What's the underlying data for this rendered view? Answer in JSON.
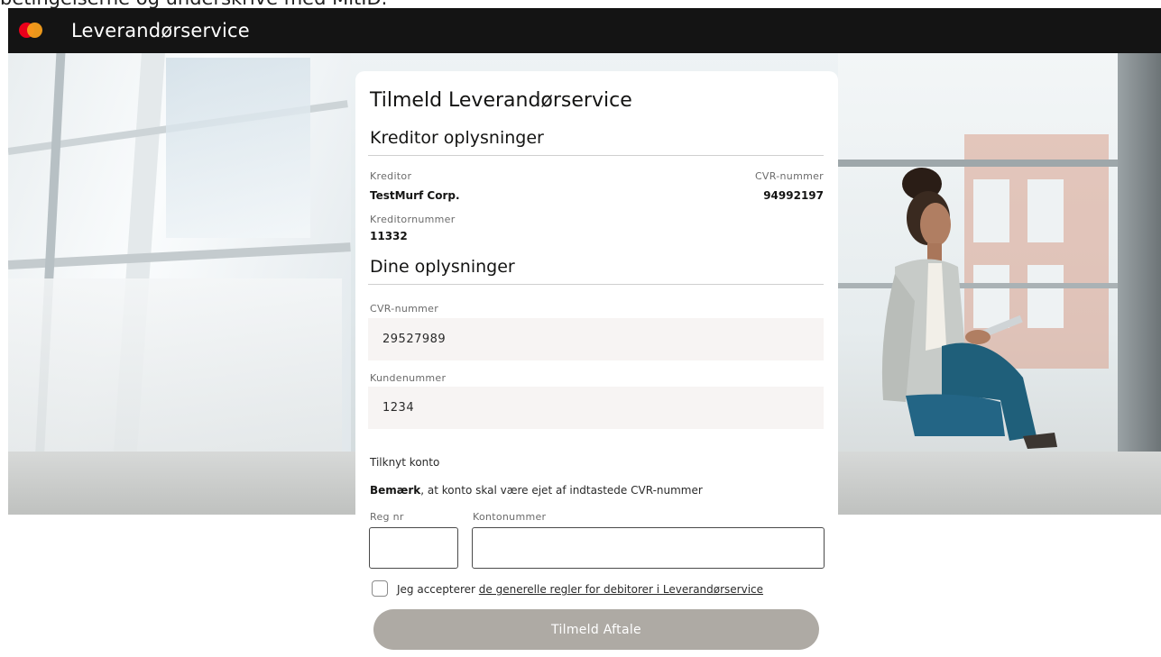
{
  "caption": "betingelserne og underskrive med MitID.",
  "header": {
    "title": "Leverandørservice",
    "logo_icon": "mastercard-logo"
  },
  "form": {
    "title": "Tilmeld Leverandørservice",
    "creditor_section": {
      "heading": "Kreditor oplysninger",
      "creditor_label": "Kreditor",
      "creditor_value": "TestMurf Corp.",
      "cvr_label": "CVR-nummer",
      "cvr_value": "94992197",
      "creditor_number_label": "Kreditornummer",
      "creditor_number_value": "11332"
    },
    "your_section": {
      "heading": "Dine oplysninger",
      "cvr_label": "CVR-nummer",
      "cvr_value": "29527989",
      "customer_number_label": "Kundenummer",
      "customer_number_value": "1234"
    },
    "account": {
      "heading": "Tilknyt konto",
      "note_bold": "Bemærk",
      "note_rest": ", at konto skal være ejet af indtastede CVR-nummer",
      "reg_label": "Reg nr",
      "reg_value": "",
      "account_label": "Kontonummer",
      "account_value": ""
    },
    "accept": {
      "checked": false,
      "text": "Jeg accepterer ",
      "link": "de generelle regler for debitorer i Leverandørservice"
    },
    "submit_label": "Tilmeld Aftale"
  },
  "colors": {
    "header_bg": "#141414",
    "button_disabled": "#aeaaa4",
    "field_bg": "#f7f4f3",
    "mc_red": "#eb001b",
    "mc_orange": "#f79e1b"
  }
}
